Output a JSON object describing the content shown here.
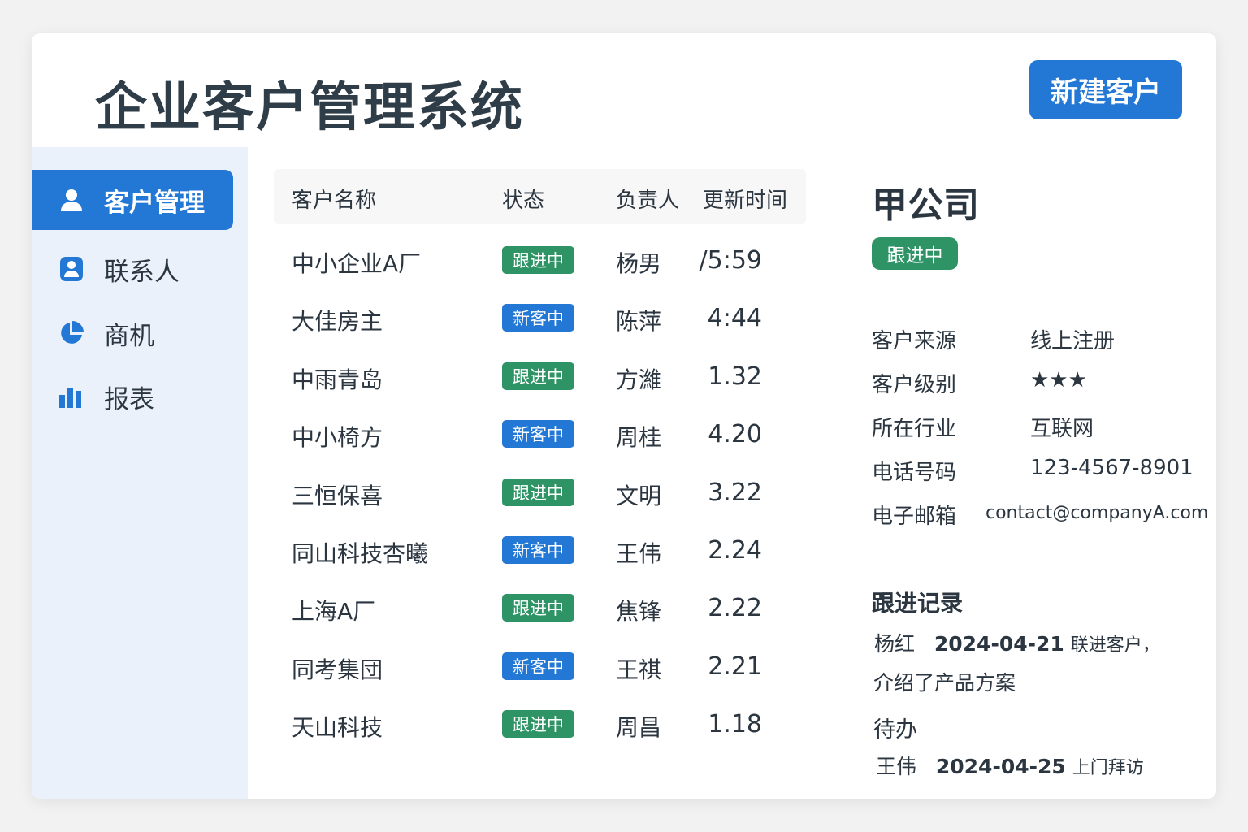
{
  "header": {
    "title": "企业客户管理系统",
    "new_customer_button": "新建客户"
  },
  "sidebar": {
    "items": [
      {
        "label": "客户管理",
        "icon": "user-icon",
        "active": true
      },
      {
        "label": "联系人",
        "icon": "contact-icon",
        "active": false
      },
      {
        "label": "商机",
        "icon": "pie-chart-icon",
        "active": false
      },
      {
        "label": "报表",
        "icon": "bar-chart-icon",
        "active": false
      }
    ]
  },
  "table": {
    "columns": [
      "客户名称",
      "状态",
      "负责人",
      "更新时间"
    ],
    "rows": [
      {
        "name": "中小企业A厂",
        "status": "跟进中",
        "status_type": "following",
        "owner": "杨男",
        "time": "/5:59"
      },
      {
        "name": "大佳房主",
        "status": "新客中",
        "status_type": "new",
        "owner": "陈萍",
        "time": "4:44"
      },
      {
        "name": "中雨青岛",
        "status": "跟进中",
        "status_type": "following",
        "owner": "方濰",
        "time": "1.32"
      },
      {
        "name": "中小椅方",
        "status": "新客中",
        "status_type": "new",
        "owner": "周桂",
        "time": "4.20"
      },
      {
        "name": "三恒保喜",
        "status": "跟进中",
        "status_type": "following",
        "owner": "文明",
        "time": "3.22"
      },
      {
        "name": "同山科技杏曦",
        "status": "新客中",
        "status_type": "new",
        "owner": "王伟",
        "time": "2.24"
      },
      {
        "name": "上海A厂",
        "status": "跟进中",
        "status_type": "following",
        "owner": "焦锋",
        "time": "2.22"
      },
      {
        "name": "同考集団",
        "status": "新客中",
        "status_type": "new",
        "owner": "王祺",
        "time": "2.21"
      },
      {
        "name": "天山科技",
        "status": "跟进中",
        "status_type": "following",
        "owner": "周昌",
        "time": "1.18"
      }
    ]
  },
  "detail": {
    "company": "甲公司",
    "status": "跟进中",
    "fields": [
      {
        "label": "客户来源",
        "value": "线上注册"
      },
      {
        "label": "客户级别",
        "value": "★★★"
      },
      {
        "label": "所在行业",
        "value": "互联网"
      },
      {
        "label": "电话号码",
        "value": "123-4567-8901"
      },
      {
        "label": "电子邮箱",
        "value": "contact@companyA.com"
      }
    ],
    "followup_title": "跟进记录",
    "followup": {
      "person": "杨红",
      "date": "2024-04-21",
      "text1": "联进客户，",
      "text2": "介绍了产品方案"
    },
    "todo_title": "待办",
    "todo": {
      "person": "王伟",
      "date": "2024-04-25",
      "text": "上门拜访"
    }
  },
  "colors": {
    "accent": "#2378d6",
    "following": "#2e9466",
    "new": "#2378d6",
    "sidebar_bg": "#eaf1fb"
  }
}
